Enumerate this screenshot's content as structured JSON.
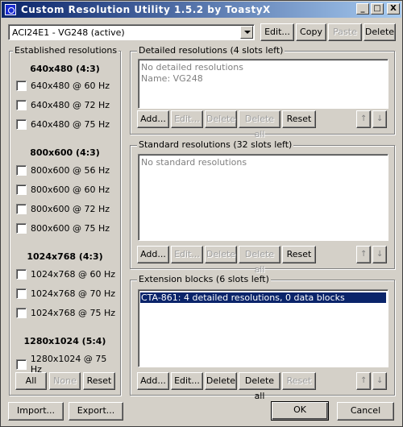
{
  "window": {
    "title": "Custom Resolution Utility 1.5.2 by ToastyX",
    "min_glyph": "_",
    "max_glyph": "□",
    "close_glyph": "X"
  },
  "toolbar": {
    "monitor_value": "ACI24E1 - VG248 (active)",
    "edit_label": "Edit...",
    "copy_label": "Copy",
    "paste_label": "Paste",
    "delete_label": "Delete"
  },
  "established": {
    "title": "Established resolutions",
    "sections": [
      {
        "header": "640x480 (4:3)",
        "items": [
          "640x480 @ 60 Hz",
          "640x480 @ 72 Hz",
          "640x480 @ 75 Hz"
        ]
      },
      {
        "header": "800x600 (4:3)",
        "items": [
          "800x600 @ 56 Hz",
          "800x600 @ 60 Hz",
          "800x600 @ 72 Hz",
          "800x600 @ 75 Hz"
        ]
      },
      {
        "header": "1024x768 (4:3)",
        "items": [
          "1024x768 @ 60 Hz",
          "1024x768 @ 70 Hz",
          "1024x768 @ 75 Hz"
        ]
      },
      {
        "header": "1280x1024 (5:4)",
        "items": [
          "1280x1024 @ 75 Hz"
        ]
      }
    ],
    "all_label": "All",
    "none_label": "None",
    "reset_label": "Reset"
  },
  "detailed": {
    "title": "Detailed resolutions (4 slots left)",
    "lines": [
      "No detailed resolutions",
      "Name: VG248"
    ],
    "add_label": "Add...",
    "edit_label": "Edit...",
    "delete_label": "Delete",
    "delete_all_label": "Delete all",
    "reset_label": "Reset"
  },
  "standard": {
    "title": "Standard resolutions (32 slots left)",
    "lines": [
      "No standard resolutions"
    ],
    "add_label": "Add...",
    "edit_label": "Edit...",
    "delete_label": "Delete",
    "delete_all_label": "Delete all",
    "reset_label": "Reset"
  },
  "extension": {
    "title": "Extension blocks (6 slots left)",
    "lines": [
      "CTA-861: 4 detailed resolutions, 0 data blocks"
    ],
    "add_label": "Add...",
    "edit_label": "Edit...",
    "delete_label": "Delete",
    "delete_all_label": "Delete all",
    "reset_label": "Reset"
  },
  "arrows": {
    "up": "↑",
    "down": "↓"
  },
  "footer": {
    "import_label": "Import...",
    "export_label": "Export...",
    "ok_label": "OK",
    "cancel_label": "Cancel"
  }
}
